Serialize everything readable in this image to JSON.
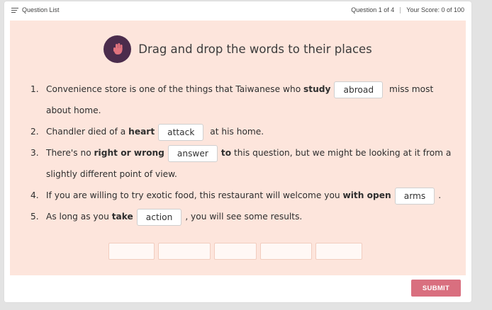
{
  "topbar": {
    "question_list_label": "Question List",
    "question_counter": "Question 1 of 4",
    "score": "Your Score: 0 of 100"
  },
  "instruction": "Drag and drop the words to their places",
  "questions": [
    {
      "num": "1.",
      "before": "Convenience store is one of the things that Taiwanese who ",
      "bold": "study",
      "answer": "abroad",
      "after": " miss most about home."
    },
    {
      "num": "2.",
      "before": "Chandler died of a ",
      "bold": "heart",
      "answer": "attack",
      "after": " at his home."
    },
    {
      "num": "3.",
      "before": "There's no ",
      "bold": "right or wrong",
      "answer": "answer",
      "bold_after": "to",
      "after": " this question, but we might be looking at it from a slightly different point of view."
    },
    {
      "num": "4.",
      "before": "If you are willing to try exotic food, this restaurant will welcome you ",
      "bold": "with open",
      "answer": "arms",
      "after": "."
    },
    {
      "num": "5.",
      "before": "As long as you ",
      "bold": "take",
      "answer": "action",
      "after": ", you will see some results."
    }
  ],
  "word_bank_slots": 5,
  "submit_label": "SUBMIT",
  "colors": {
    "panel": "#fde5dc",
    "badge": "#4b2c4c",
    "hand": "#e0737e",
    "submit": "#d96f7f"
  }
}
